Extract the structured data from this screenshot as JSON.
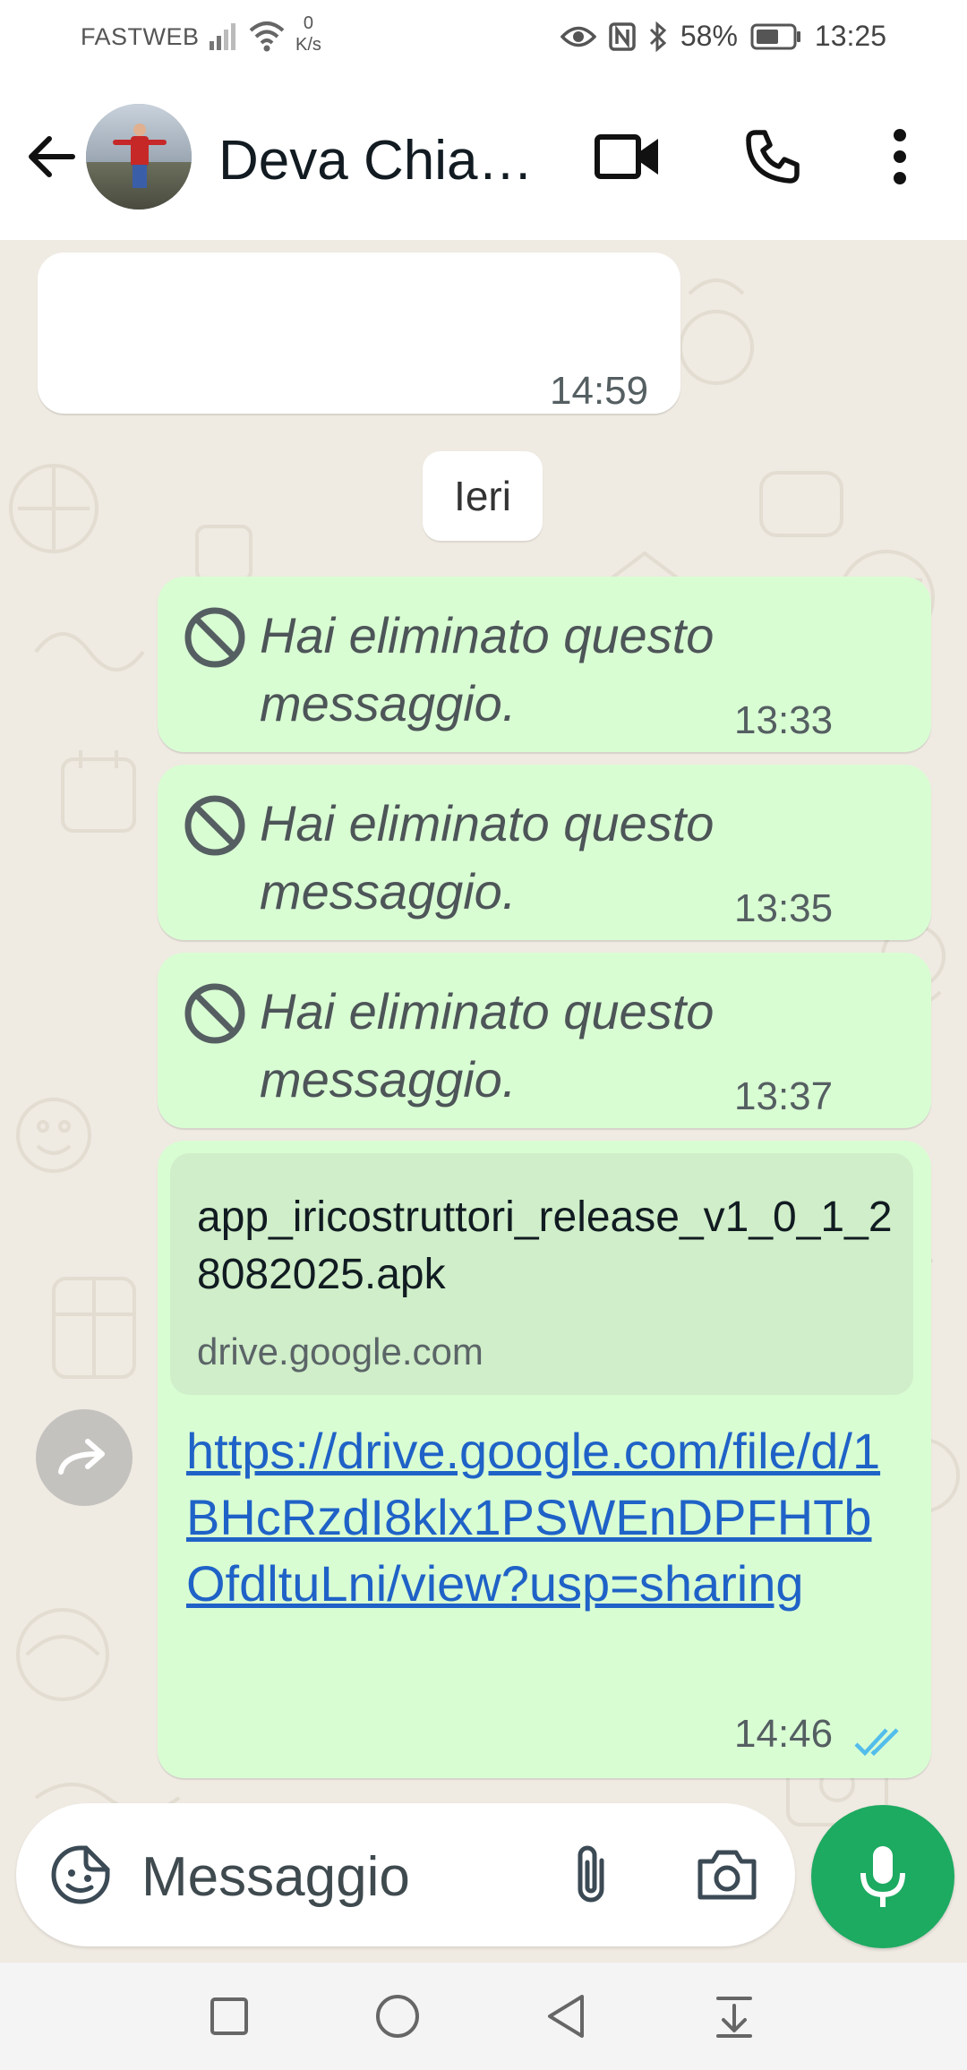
{
  "status_bar": {
    "carrier": "FASTWEB",
    "net_speed_value": "0",
    "net_speed_unit": "K/s",
    "battery": "58%",
    "time": "13:25",
    "icons": [
      "signal-icon",
      "wifi-icon",
      "eye-icon",
      "nfc-icon",
      "bluetooth-icon",
      "battery-icon"
    ]
  },
  "header": {
    "contact_name": "Deva Chia…",
    "icons": [
      "back-arrow-icon",
      "avatar",
      "video-call-icon",
      "phone-icon",
      "more-vert-icon"
    ]
  },
  "messages": [
    {
      "direction": "in",
      "text": "",
      "time": "14:59"
    },
    {
      "type": "date",
      "label": "Ieri"
    },
    {
      "direction": "out",
      "deleted": true,
      "text": "Hai eliminato questo messaggio.",
      "time": "13:33"
    },
    {
      "direction": "out",
      "deleted": true,
      "text": "Hai eliminato questo messaggio.",
      "time": "13:35"
    },
    {
      "direction": "out",
      "deleted": true,
      "text": "Hai eliminato questo messaggio.",
      "time": "13:37"
    },
    {
      "direction": "out",
      "preview_title": "app_iricostruttori_release_v1_0_1_28082025.apk",
      "preview_domain": "drive.google.com",
      "link": "https://drive.google.com/file/d/1BHcRzdI8klx1PSWEnDPFHTbOfdltuLni/view?usp=sharing",
      "time": "14:46",
      "read": true
    }
  ],
  "composer": {
    "placeholder": "Messaggio",
    "icons": [
      "sticker-emoji-icon",
      "attach-icon",
      "camera-icon",
      "mic-icon"
    ]
  },
  "colors": {
    "chat_background": "#efeae2",
    "outgoing_bubble": "#d9fdd3",
    "incoming_bubble": "#ffffff",
    "accent_green": "#1daa61",
    "link_blue": "#1f62c7",
    "read_ticks": "#53bdeb"
  },
  "nav_bar": {
    "icons": [
      "recent-apps-icon",
      "home-icon",
      "back-icon",
      "notification-pull-icon"
    ]
  }
}
